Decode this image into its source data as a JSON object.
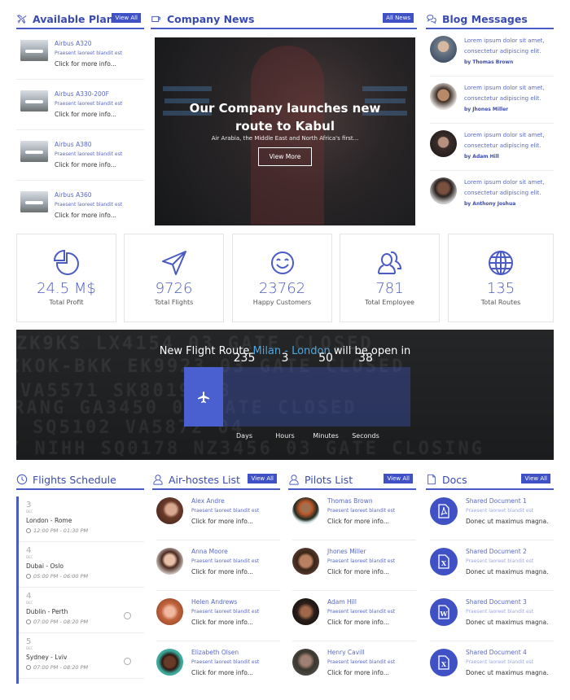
{
  "planes": {
    "title": "Available Planes",
    "view_all": "View All",
    "items": [
      {
        "name": "Airbus A320",
        "sub": "Praesent laoreet blandit est",
        "more": "Click for more info..."
      },
      {
        "name": "Airbus A330-200F",
        "sub": "Praesent laoreet blandit est",
        "more": "Click for more info..."
      },
      {
        "name": "Airbus A380",
        "sub": "Praesent laoreet blandit est",
        "more": "Click for more info..."
      },
      {
        "name": "Airbus A360",
        "sub": "Praesent laoreet blandit est",
        "more": "Click for more info..."
      }
    ]
  },
  "news": {
    "title": "Company News",
    "all_news": "All News",
    "headline": "Our Company launches new route to Kabul",
    "description": "Air Arabia, the Middle East and North Africa's first...",
    "button": "View More"
  },
  "blog": {
    "title": "Blog Messages",
    "items": [
      {
        "text": "Lorem ipsum dolor sit amet, consectetur adipiscing elit.",
        "author": "by Thomas Brown",
        "color": "#6d7b88"
      },
      {
        "text": "Lorem ipsum dolor sit amet, consectetur adipiscing elit.",
        "author": "by Jhones Miller",
        "color": "#9a6e55"
      },
      {
        "text": "Lorem ipsum dolor sit amet, consectetur adipiscing elit.",
        "author": "by Adam Hill",
        "color": "#3a2d2a"
      },
      {
        "text": "Lorem ipsum dolor sit amet, consectetur adipiscing elit.",
        "author": "by Anthony Joshua",
        "color": "#4b3a33"
      }
    ]
  },
  "stats": [
    {
      "icon": "pie-chart-icon",
      "value": "24.5 M$",
      "label": "Total Profit"
    },
    {
      "icon": "paper-plane-icon",
      "value": "9726",
      "label": "Total Flights"
    },
    {
      "icon": "smiley-icon",
      "value": "23762",
      "label": "Happy Customers"
    },
    {
      "icon": "users-icon",
      "value": "781",
      "label": "Total Employee"
    },
    {
      "icon": "globe-icon",
      "value": "135",
      "label": "Total Routes"
    }
  ],
  "countdown": {
    "prefix": "New Flight Route",
    "route": "Milan - London",
    "suffix": "will be open in",
    "values": [
      {
        "value": "235",
        "label": "Days"
      },
      {
        "value": "3",
        "label": "Hours"
      },
      {
        "value": "50",
        "label": "Minutes"
      },
      {
        "value": "38",
        "label": "Seconds"
      }
    ]
  },
  "schedule": {
    "title": "Flights Schedule",
    "items": [
      {
        "day": "3",
        "month": "DEC",
        "route": "London - Rome",
        "time": "12:00 PM - 01:30 PM",
        "sync": false
      },
      {
        "day": "4",
        "month": "DEC",
        "route": "Dubai - Oslo",
        "time": "05:00 PM - 06:00 PM",
        "sync": false
      },
      {
        "day": "4",
        "month": "DEC",
        "route": "Dublin - Perth",
        "time": "07:00 PM - 08:20 PM",
        "sync": true
      },
      {
        "day": "5",
        "month": "DEC",
        "route": "Sydney - Lviv",
        "time": "07:00 PM - 08:20 PM",
        "sync": true
      }
    ]
  },
  "hostesses": {
    "title": "Air-hostes List",
    "view_all": "View All",
    "items": [
      {
        "name": "Alex Andre",
        "sub": "Praesent laoreet blandit est",
        "more": "Click for more info...",
        "color": "#7a4a3a"
      },
      {
        "name": "Anna Moore",
        "sub": "Praesent laoreet blandit est",
        "more": "Click for more info...",
        "color": "#5a3a2e"
      },
      {
        "name": "Helen Andrews",
        "sub": "Praesent laoreet blandit est",
        "more": "Click for more info...",
        "color": "#c0643c"
      },
      {
        "name": "Elizabeth Olsen",
        "sub": "Praesent laoreet blandit est",
        "more": "Click for more info...",
        "color": "#3aa89a"
      }
    ]
  },
  "pilots": {
    "title": "Pilots List",
    "view_all": "View All",
    "items": [
      {
        "name": "Thomas Brown",
        "sub": "Praesent laoreet blandit est",
        "more": "Click for more info...",
        "color": "#b8c8c8"
      },
      {
        "name": "Jhones Miller",
        "sub": "Praesent laoreet blandit est",
        "more": "Click for more info...",
        "color": "#5a4030"
      },
      {
        "name": "Adam Hill",
        "sub": "Praesent laoreet blandit est",
        "more": "Click for more info...",
        "color": "#2a1e1a"
      },
      {
        "name": "Henry Cavill",
        "sub": "Praesent laoreet blandit est",
        "more": "Click for more info...",
        "color": "#4a4a44"
      }
    ]
  },
  "docs": {
    "title": "Docs",
    "view_all": "View All",
    "items": [
      {
        "name": "Shared Document 1",
        "sub": "Praesent laoreet blandit est",
        "more": "Donec ut maximus magna.",
        "type": "pdf",
        "glyph": "A"
      },
      {
        "name": "Shared Document 2",
        "sub": "Praesent laoreet blandit est",
        "more": "Donec ut maximus magna.",
        "type": "excel",
        "glyph": "X"
      },
      {
        "name": "Shared Document 3",
        "sub": "Praesent laoreet blandit est",
        "more": "Donec ut maximus magna.",
        "type": "word",
        "glyph": "W"
      },
      {
        "name": "Shared Document 4",
        "sub": "Praesent laoreet blandit est",
        "more": "Donec ut maximus magna.",
        "type": "excel",
        "glyph": "X"
      }
    ]
  }
}
